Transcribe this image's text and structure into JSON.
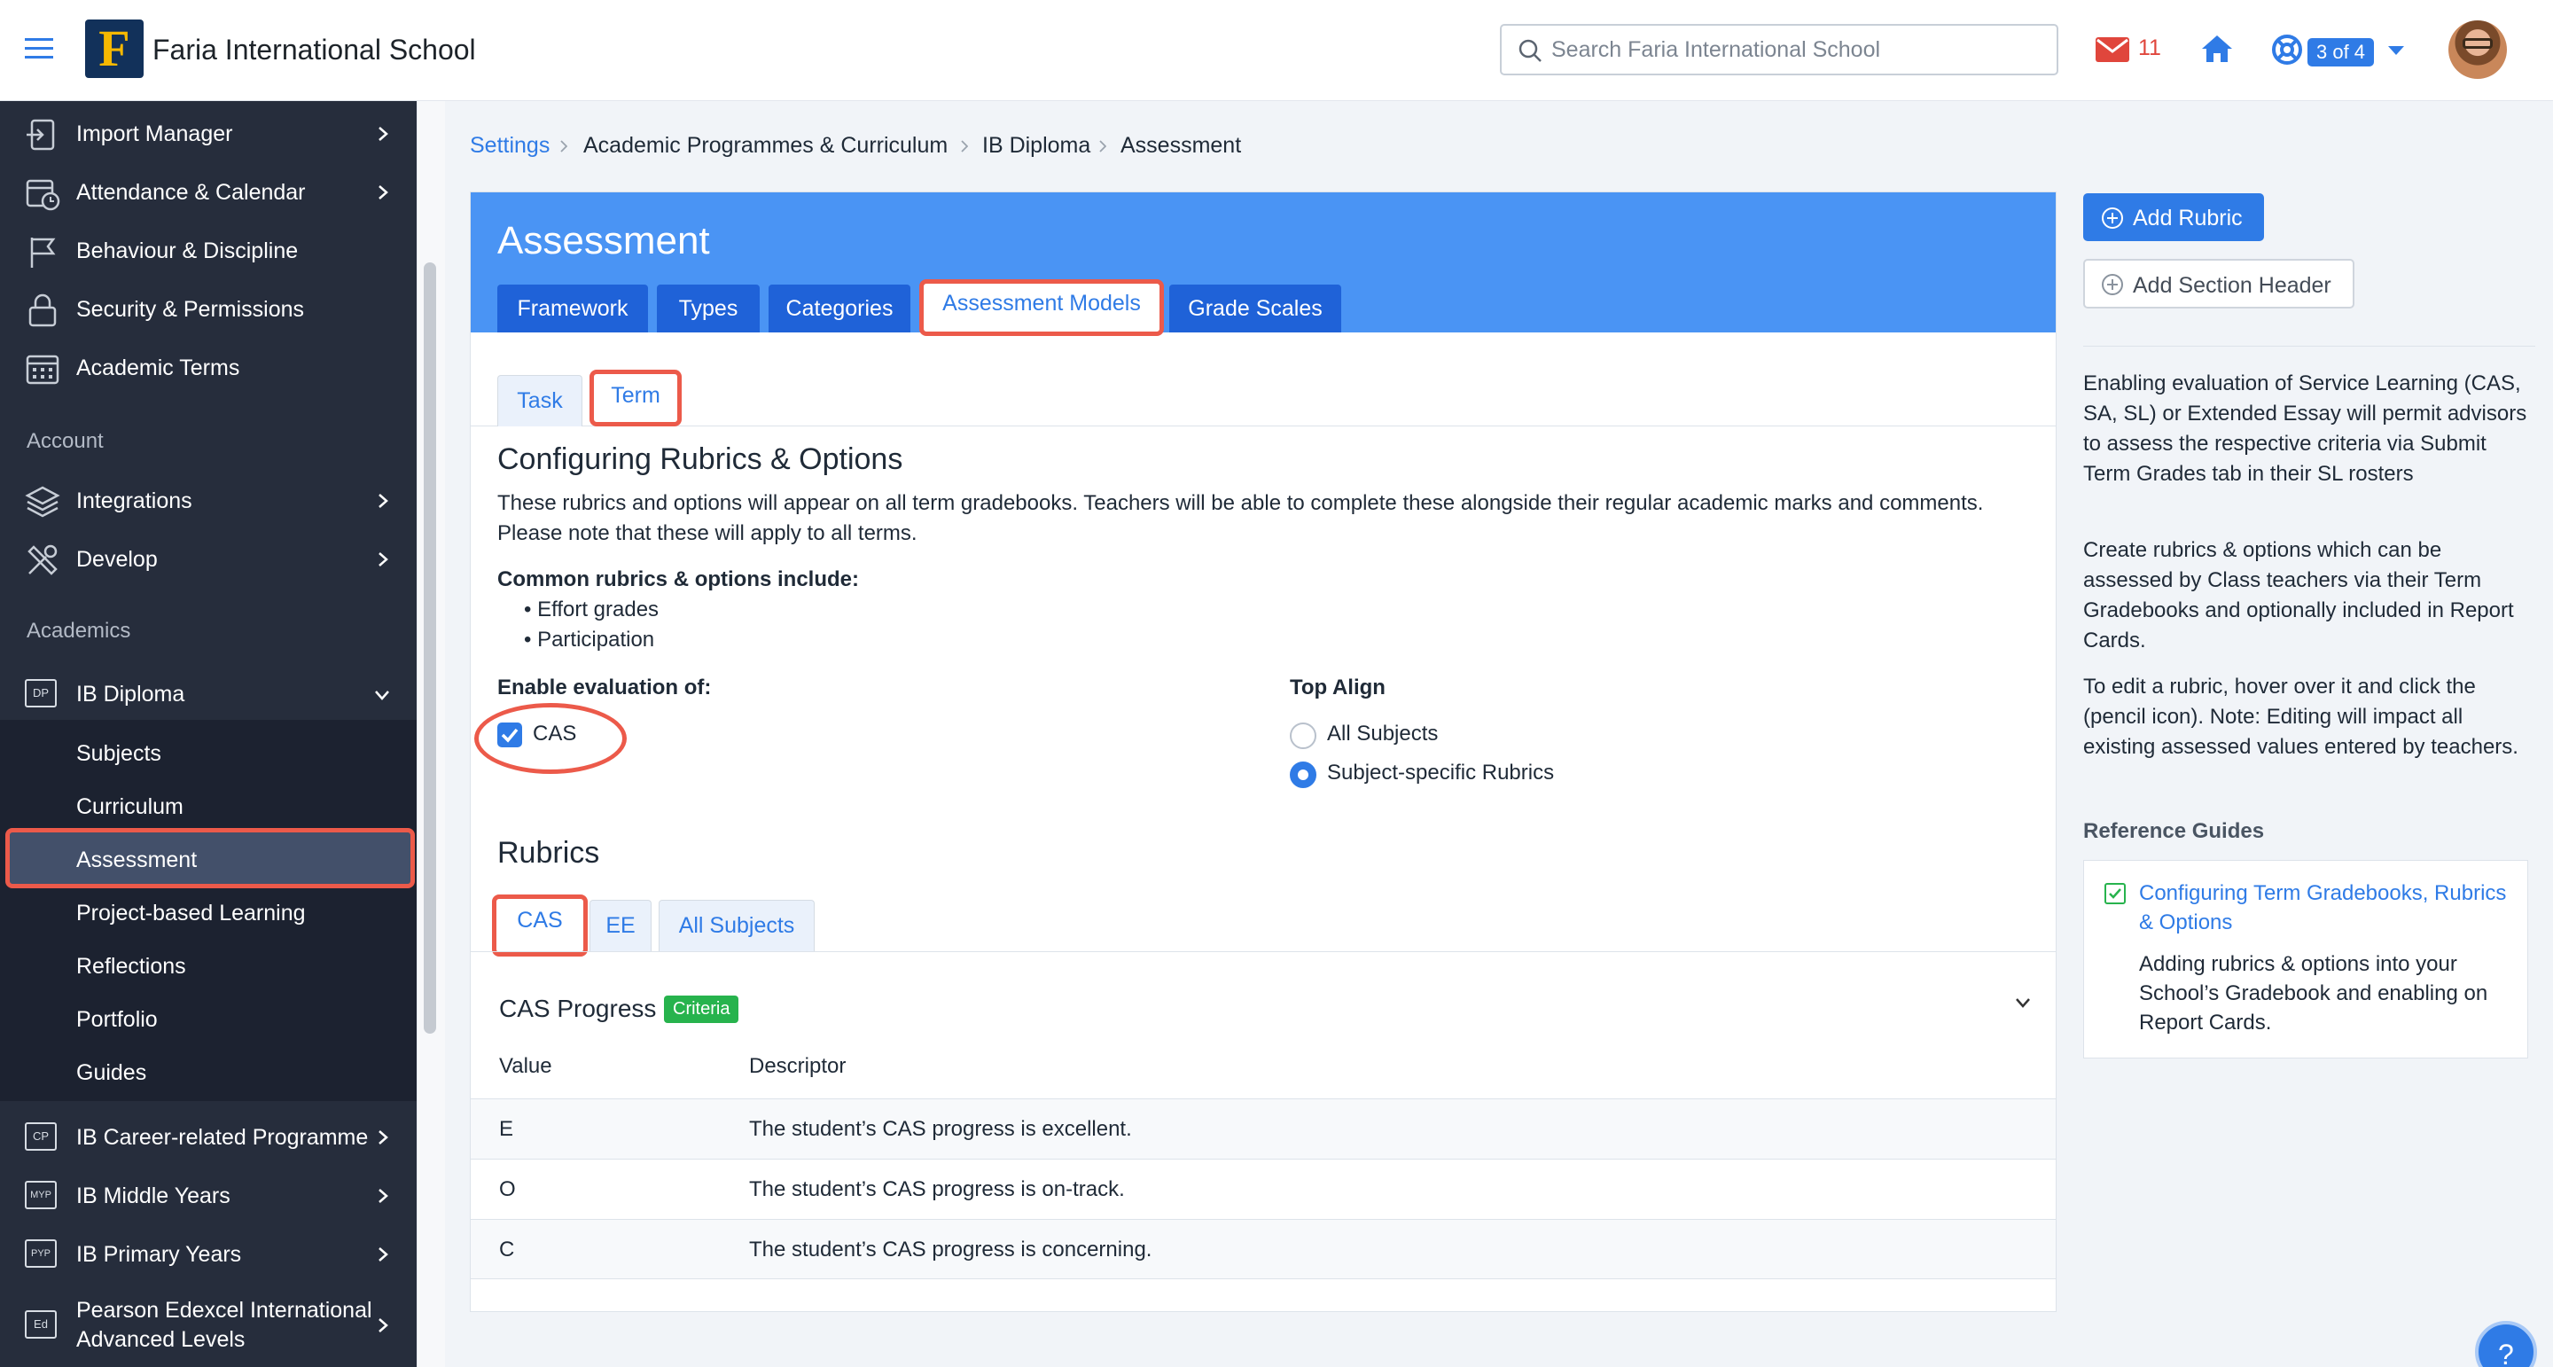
{
  "header": {
    "logo_letter": "F",
    "school_name": "Faria International School",
    "search_placeholder": "Search Faria International School",
    "mail_count": "11",
    "page_badge": "3 of 4"
  },
  "sidebar": {
    "items_top": [
      {
        "label": "Import Manager",
        "icon": "import-icon"
      },
      {
        "label": "Attendance & Calendar",
        "icon": "calendar-clock-icon"
      },
      {
        "label": "Behaviour & Discipline",
        "icon": "flag-icon"
      },
      {
        "label": "Security & Permissions",
        "icon": "lock-icon"
      },
      {
        "label": "Academic Terms",
        "icon": "calendar-icon"
      }
    ],
    "section_account": "Account",
    "items_account": [
      {
        "label": "Integrations",
        "icon": "layers-icon"
      },
      {
        "label": "Develop",
        "icon": "tools-icon"
      }
    ],
    "section_academics": "Academics",
    "ib_diploma": {
      "label": "IB Diploma",
      "badge": "DP"
    },
    "submenu": [
      "Subjects",
      "Curriculum",
      "Assessment",
      "Project-based Learning",
      "Reflections",
      "Portfolio",
      "Guides"
    ],
    "programmes": [
      {
        "label": "IB Career-related Programme",
        "badge": "CP"
      },
      {
        "label": "IB Middle Years",
        "badge": "MYP"
      },
      {
        "label": "IB Primary Years",
        "badge": "PYP"
      },
      {
        "label": "Pearson Edexcel International Advanced Levels",
        "badge": "Ed"
      }
    ]
  },
  "breadcrumb": [
    "Settings",
    "Academic Programmes & Curriculum",
    "IB Diploma",
    "Assessment"
  ],
  "main": {
    "title": "Assessment",
    "tabs": [
      "Framework",
      "Types",
      "Categories",
      "Assessment Models",
      "Grade Scales"
    ],
    "subtabs": [
      "Task",
      "Term"
    ],
    "config_title": "Configuring Rubrics & Options",
    "config_desc": "These rubrics and options will appear on all term gradebooks. Teachers will be able to complete these alongside their regular academic marks and comments. Please note that these will apply to all terms.",
    "common_title": "Common rubrics & options include:",
    "common_items": [
      "Effort grades",
      "Participation"
    ],
    "enable_label": "Enable evaluation of:",
    "cas_label": "CAS",
    "top_align_label": "Top Align",
    "radio_options": [
      "All Subjects",
      "Subject-specific Rubrics"
    ],
    "radio_selected": "Subject-specific Rubrics",
    "rubrics_title": "Rubrics",
    "rubric_tabs": [
      "CAS",
      "EE",
      "All Subjects"
    ],
    "rubric_name": "CAS Progress",
    "rubric_badge": "Criteria",
    "table_headers": [
      "Value",
      "Descriptor"
    ],
    "table_rows": [
      {
        "value": "E",
        "descriptor": "The student’s CAS progress is excellent."
      },
      {
        "value": "O",
        "descriptor": "The student’s CAS progress is on-track."
      },
      {
        "value": "C",
        "descriptor": "The student’s CAS progress is concerning."
      }
    ]
  },
  "right": {
    "add_rubric": "Add Rubric",
    "add_section_header": "Add Section Header",
    "text1": "Enabling evaluation of Service Learning (CAS, SA, SL) or Extended Essay will permit advisors to assess the respective criteria via Submit Term Grades tab in their SL rosters",
    "text2": "Create rubrics & options which can be assessed by Class teachers via their Term Gradebooks and optionally included in Report Cards.",
    "text3": "To edit a rubric, hover over it and click the (pencil icon). Note: Editing will impact all existing assessed values entered by teachers.",
    "ref_title": "Reference Guides",
    "ref_link": "Configuring Term Gradebooks, Rubrics & Options",
    "ref_desc": "Adding rubrics & options into your School’s Gradebook and enabling on Report Cards.",
    "help": "?"
  },
  "colors": {
    "accent": "#2f7be6",
    "header_blue": "#4a94f4",
    "tab_blue": "#1f62d8",
    "highlight": "#ec5a4a",
    "sidebar": "#262d3c",
    "criteria_green": "#27b34d"
  }
}
